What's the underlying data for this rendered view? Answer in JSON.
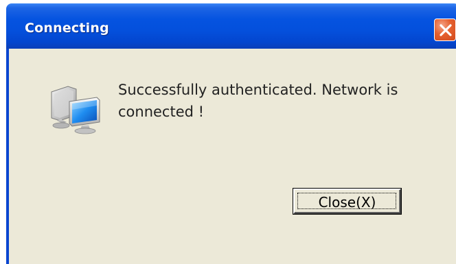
{
  "window": {
    "title": "Connecting"
  },
  "title_bar": {
    "close_icon": "close-x-icon"
  },
  "dialog": {
    "icon": "network-computers-icon",
    "message": "Successfully authenticated. Network is connected !",
    "close_button_label": "Close(X)"
  },
  "colors": {
    "title_bar": "#0553e0",
    "close_button": "#e5602f",
    "dialog_background": "#ece9d8",
    "text": "#222222"
  }
}
